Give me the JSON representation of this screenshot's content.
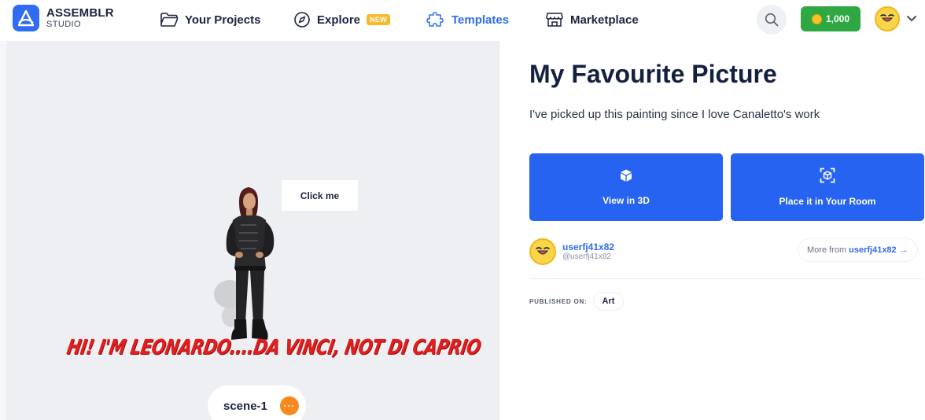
{
  "brand": {
    "name": "ASSEMBLR",
    "sub": "STUDIO"
  },
  "nav": {
    "projects": "Your Projects",
    "explore": "Explore",
    "explore_badge": "NEW",
    "templates": "Templates",
    "marketplace": "Marketplace"
  },
  "account": {
    "coins": "1,000"
  },
  "scene": {
    "tooltip": "Click me",
    "banner": "HI! I'M LEONARDO....DA VINCI, NOT DI CAPRIO",
    "scene_name": "scene-1",
    "more_icon": "···"
  },
  "detail": {
    "title": "My Favourite Picture",
    "description": "I've picked up this painting since I love Canaletto's work",
    "view_3d": "View in 3D",
    "place_room": "Place it in Your Room",
    "author_name": "userfj41x82",
    "author_handle": "@userfj41x82",
    "more_from_prefix": "More from",
    "more_from_user": "userfj41x82",
    "more_from_arrow": "→",
    "published_label": "PUBLISHED ON:",
    "published_tag": "Art"
  },
  "colors": {
    "accent": "#2f6cf0",
    "action": "#2563f0",
    "coin_pill": "#2fa742",
    "badge": "#f7b929",
    "banner_text": "#e41e1e"
  },
  "icons": [
    "assemblr-logo-icon",
    "folder-icon",
    "compass-icon",
    "puzzle-icon",
    "store-icon",
    "search-icon",
    "coin-icon",
    "avatar-face-icon",
    "chevron-down-icon",
    "cube-icon",
    "ar-scan-icon"
  ]
}
